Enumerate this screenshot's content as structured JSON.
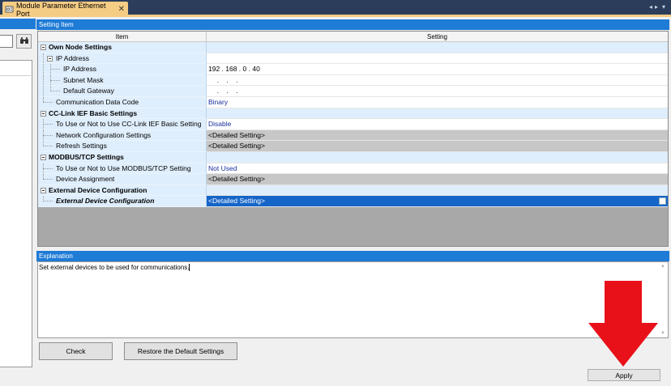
{
  "tab": {
    "title": "Module Parameter Ethernet Port",
    "close_glyph": "✕"
  },
  "tabstrip_controls": {
    "left": "◂",
    "right": "▸",
    "menu": "▾"
  },
  "setting_item": {
    "header": "Setting Item",
    "columns": {
      "item": "Item",
      "setting": "Setting"
    }
  },
  "rows": [
    {
      "label": "Own Node Settings",
      "value": ""
    },
    {
      "label": "IP Address",
      "value": ""
    },
    {
      "label": "IP Address",
      "value": "192 . 168 .  0 . 40"
    },
    {
      "label": "Subnet Mask",
      "value": "  .    .    ."
    },
    {
      "label": "Default Gateway",
      "value": "  .    .    ."
    },
    {
      "label": "Communication Data Code",
      "value": "Binary"
    },
    {
      "label": "CC-Link IEF Basic Settings",
      "value": ""
    },
    {
      "label": "To Use or Not to Use CC-Link IEF Basic Setting",
      "value": "Disable"
    },
    {
      "label": "Network Configuration Settings",
      "value": "<Detailed Setting>"
    },
    {
      "label": "Refresh Settings",
      "value": "<Detailed Setting>"
    },
    {
      "label": "MODBUS/TCP Settings",
      "value": ""
    },
    {
      "label": "To Use or Not to Use MODBUS/TCP Setting",
      "value": "Not Used"
    },
    {
      "label": "Device Assignment",
      "value": "<Detailed Setting>"
    },
    {
      "label": "External Device Configuration",
      "value": ""
    },
    {
      "label": "External Device Configuration",
      "value": "<Detailed Setting>"
    }
  ],
  "explanation": {
    "header": "Explanation",
    "text": "Set external devices to be used for communications."
  },
  "buttons": {
    "check": "Check",
    "restore": "Restore the Default Settings",
    "apply": "Apply"
  },
  "colors": {
    "accent_blue": "#1e7bd6",
    "tab_gold": "#f5cc84",
    "tabstrip_navy": "#2b3d5b",
    "selected_row": "#1565c8",
    "arrow_red": "#e8111a"
  }
}
